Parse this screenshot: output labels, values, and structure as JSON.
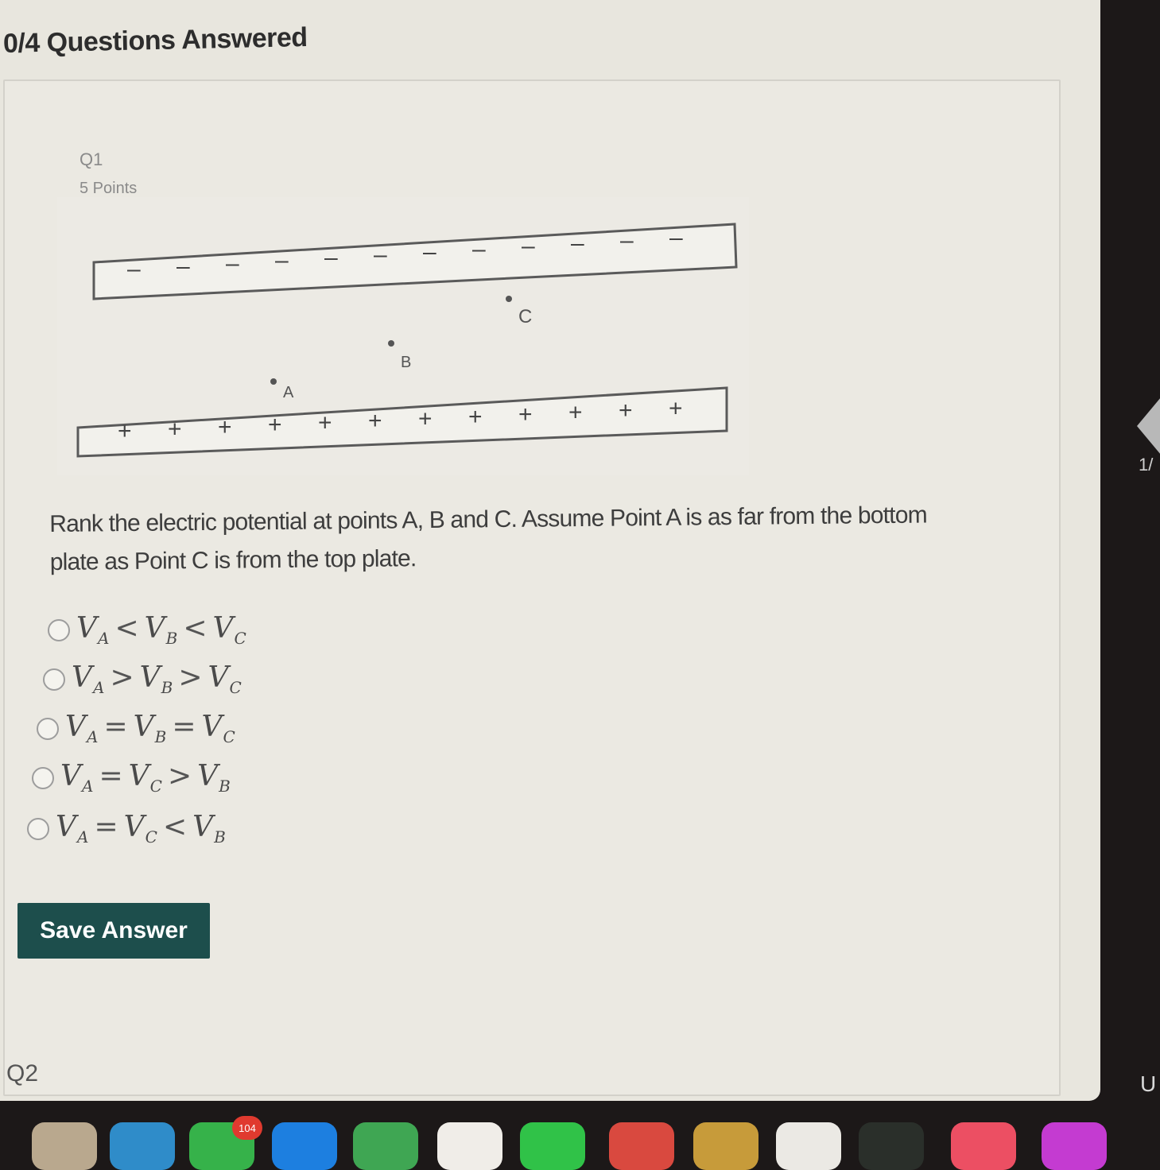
{
  "header": {
    "progress": "0/4 Questions Answered"
  },
  "question": {
    "label": "Q1",
    "points": "5 Points",
    "text": "Rank the electric potential at points A, B and C. Assume Point A is as far from the bottom plate as Point C is from the top plate."
  },
  "diagram": {
    "top_plate_sign": "–",
    "bottom_plate_sign": "+",
    "point_a": "A",
    "point_b": "B",
    "point_c": "C"
  },
  "options": [
    {
      "a": "V",
      "as": "A",
      "op1": "<",
      "b": "V",
      "bs": "B",
      "op2": "<",
      "c": "V",
      "cs": "C"
    },
    {
      "a": "V",
      "as": "A",
      "op1": ">",
      "b": "V",
      "bs": "B",
      "op2": ">",
      "c": "V",
      "cs": "C"
    },
    {
      "a": "V",
      "as": "A",
      "op1": "=",
      "b": "V",
      "bs": "B",
      "op2": "=",
      "c": "V",
      "cs": "C"
    },
    {
      "a": "V",
      "as": "A",
      "op1": "=",
      "b": "V",
      "bs": "C",
      "op2": ">",
      "c": "V",
      "cs": "B"
    },
    {
      "a": "V",
      "as": "A",
      "op1": "=",
      "b": "V",
      "bs": "C",
      "op2": "<",
      "c": "V",
      "cs": "B"
    }
  ],
  "save_button": "Save Answer",
  "next_question_label": "Q2",
  "side_panel": {
    "page_indicator": "1/",
    "letter": "U"
  },
  "dock": {
    "badge_count": "104"
  }
}
